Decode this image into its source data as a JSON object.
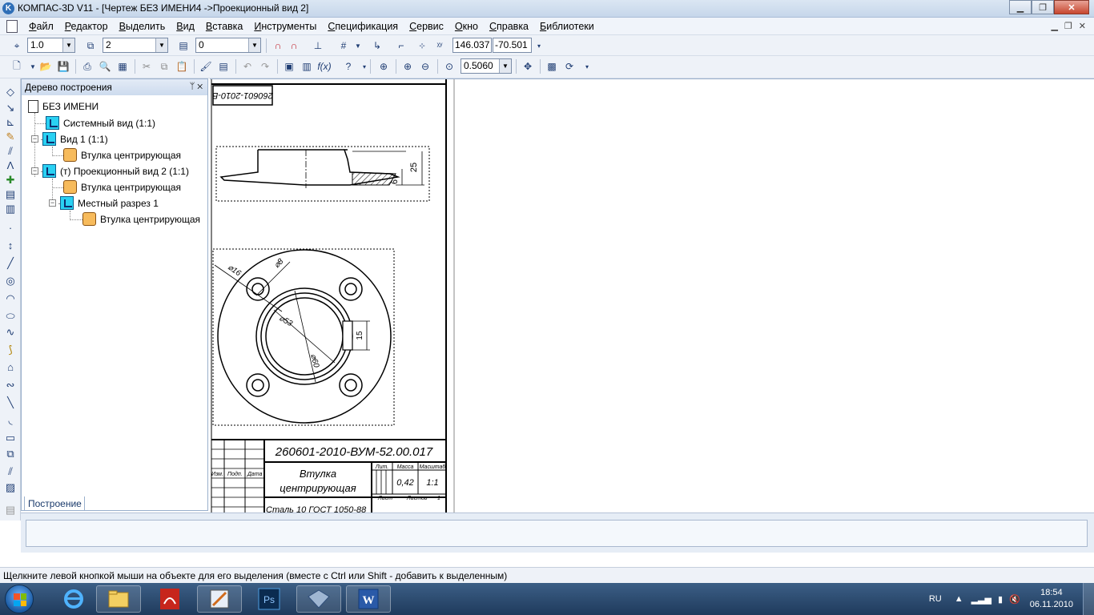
{
  "window": {
    "title": "КОМПАС-3D V11 - [Чертеж БЕЗ ИМЕНИ4 ->Проекционный вид 2]",
    "app_icon_letter": "K"
  },
  "menu": {
    "items": [
      "Файл",
      "Редактор",
      "Выделить",
      "Вид",
      "Вставка",
      "Инструменты",
      "Спецификация",
      "Сервис",
      "Окно",
      "Справка",
      "Библиотеки"
    ]
  },
  "toolbar1": {
    "line_scale": "1.0",
    "layer": "2",
    "style": "0",
    "coord_x": "146.037",
    "coord_y": "-70.501"
  },
  "toolbar2": {
    "zoom": "0.5060"
  },
  "tree": {
    "title": "Дерево построения",
    "tab_label": "Построение",
    "nodes": [
      {
        "label": "БЕЗ ИМЕНИ"
      },
      {
        "label": "Системный вид (1:1)"
      },
      {
        "label": "Вид 1 (1:1)"
      },
      {
        "label": "Втулка центрирующая"
      },
      {
        "label": "(т) Проекционный вид 2 (1:1)"
      },
      {
        "label": "Втулка центрирующая"
      },
      {
        "label": "Местный разрез 1"
      },
      {
        "label": "Втулка центрирующая"
      }
    ]
  },
  "drawing": {
    "stamp_code_rotated": "260601-2010-В",
    "doc_code": "260601-2010-ВУМ-52.00.017",
    "part_name_line1": "Втулка",
    "part_name_line2": "центрирующая",
    "mass_header": "Масса",
    "lit_header": "Лит.",
    "scale_header": "Масштаб",
    "mass_value": "0,42",
    "scale_value": "1:1",
    "sheet_label": "Лист",
    "sheets_label": "Листов",
    "sheets_value": "1",
    "material": "Сталь 10  ГОСТ 1050-88",
    "col_izm": "Изм.",
    "col_podp": "Подп.",
    "col_data": "Дата",
    "dim_25": "25",
    "dim_6": "6",
    "dim_d16": "⌀16",
    "dim_d8": "⌀8",
    "dim_d53": "⌀53",
    "dim_d60": "⌀60",
    "dim_15": "15"
  },
  "status": {
    "hint": "Щелкните левой кнопкой мыши на объекте для его выделения (вместе с Ctrl или Shift - добавить к выделенным)"
  },
  "taskbar": {
    "lang": "RU",
    "time": "18:54",
    "date": "06.11.2010"
  }
}
